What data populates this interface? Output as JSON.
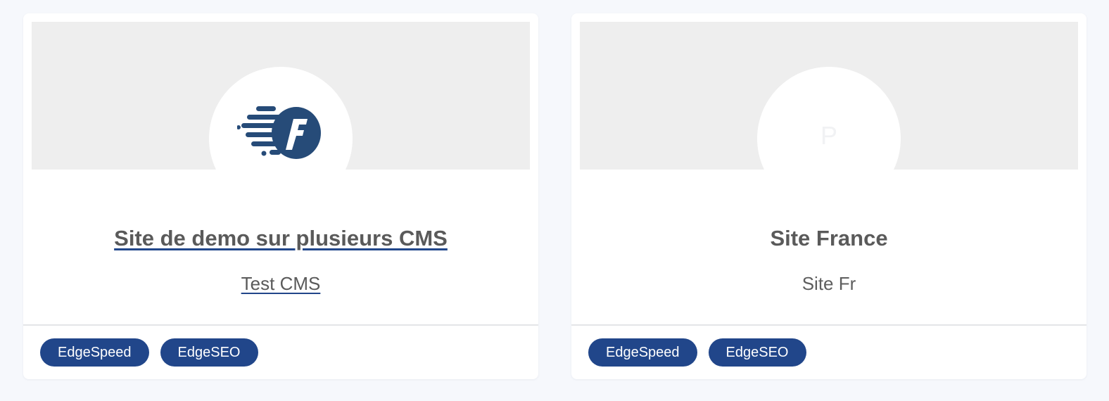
{
  "colors": {
    "page_background": "#f6f8fc",
    "banner_background": "#eeeeee",
    "tag_background": "#21468a",
    "tag_text": "#ffffff",
    "title_text": "#5a5a5a",
    "link_underline": "#21468a"
  },
  "cards": [
    {
      "avatar": {
        "type": "logo",
        "icon": "speed-f-logo-icon"
      },
      "title": "Site de demo sur plusieurs CMS",
      "subtitle": "Test CMS",
      "tags": [
        "EdgeSpeed",
        "EdgeSEO"
      ]
    },
    {
      "avatar": {
        "type": "letter",
        "letter": "P"
      },
      "title": "Site France",
      "subtitle": "Site Fr",
      "tags": [
        "EdgeSpeed",
        "EdgeSEO"
      ]
    }
  ]
}
